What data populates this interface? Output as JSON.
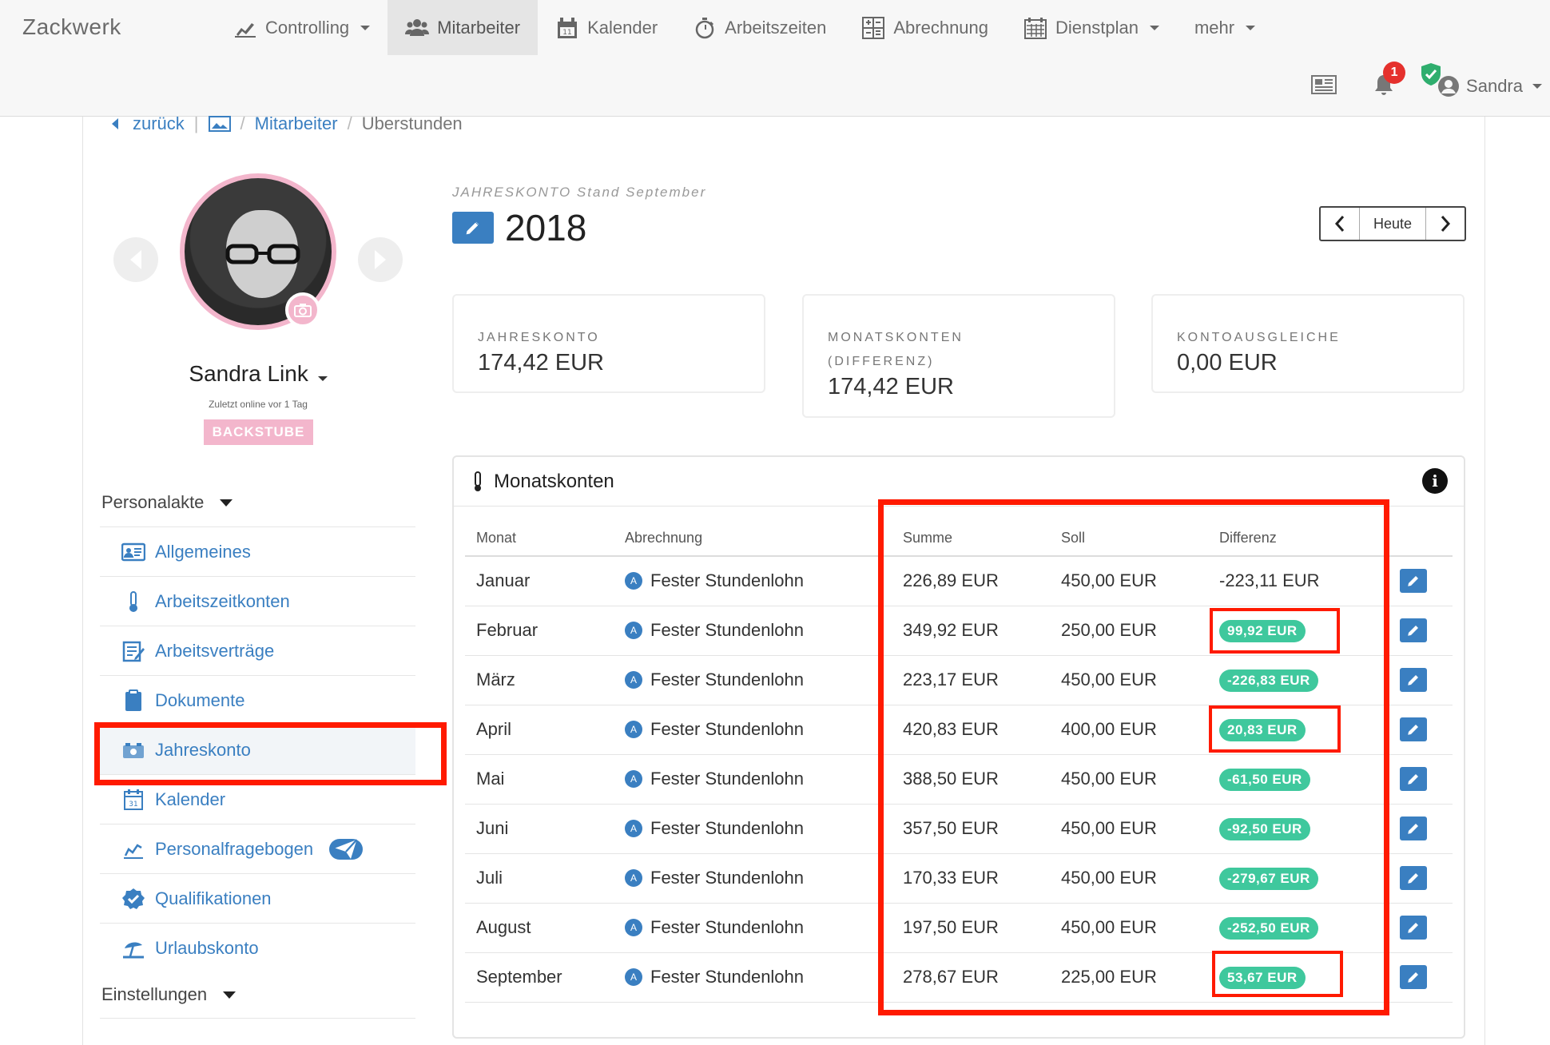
{
  "app": {
    "brand": "Zackwerk"
  },
  "nav": {
    "items": [
      {
        "label": "Controlling",
        "icon": "chart-icon",
        "dropdown": true
      },
      {
        "label": "Mitarbeiter",
        "icon": "users-icon",
        "active": true
      },
      {
        "label": "Kalender",
        "icon": "calendar-icon"
      },
      {
        "label": "Arbeitszeiten",
        "icon": "stopwatch-icon"
      },
      {
        "label": "Abrechnung",
        "icon": "calculator-icon"
      },
      {
        "label": "Dienstplan",
        "icon": "roster-icon",
        "dropdown": true
      },
      {
        "label": "mehr",
        "dropdown": true
      }
    ],
    "notifications_count": "1",
    "user_name": "Sandra"
  },
  "breadcrumb": {
    "back": "zurück",
    "parent": "Mitarbeiter",
    "current": "Uberstunden"
  },
  "profile": {
    "name": "Sandra Link",
    "last_online": "Zuletzt online vor 1 Tag",
    "department": "BACKSTUBE"
  },
  "sidebar": {
    "section_personalakte": "Personalakte",
    "items": [
      {
        "label": "Allgemeines",
        "icon": "id-card-icon"
      },
      {
        "label": "Arbeitszeitkonten",
        "icon": "thermometer-icon"
      },
      {
        "label": "Arbeitsverträge",
        "icon": "contract-icon"
      },
      {
        "label": "Dokumente",
        "icon": "clipboard-icon"
      },
      {
        "label": "Jahreskonto",
        "icon": "bank-icon",
        "active": true
      },
      {
        "label": "Kalender",
        "icon": "calendar-icon"
      },
      {
        "label": "Personalfragebogen",
        "icon": "form-icon"
      },
      {
        "label": "Qualifikationen",
        "icon": "badge-check-icon"
      },
      {
        "label": "Urlaubskonto",
        "icon": "beach-icon"
      }
    ],
    "section_einstellungen": "Einstellungen"
  },
  "header": {
    "kicker": "JAHRESKONTO Stand September",
    "year": "2018",
    "pager_today": "Heute"
  },
  "cards": [
    {
      "label": "JAHRESKONTO",
      "value": "174,42 EUR"
    },
    {
      "label": "MONATSKONTEN (DIFFERENZ)",
      "value": "174,42 EUR"
    },
    {
      "label": "KONTOAUSGLEICHE",
      "value": "0,00 EUR"
    }
  ],
  "panel": {
    "title": "Monatskonten",
    "columns": [
      "Monat",
      "Abrechnung",
      "Summe",
      "Soll",
      "Differenz"
    ],
    "rows": [
      {
        "monat": "Januar",
        "abrechnung": "Fester Stundenlohn",
        "summe": "226,89 EUR",
        "soll": "450,00 EUR",
        "differenz": "-223,11 EUR",
        "pill": false
      },
      {
        "monat": "Februar",
        "abrechnung": "Fester Stundenlohn",
        "summe": "349,92 EUR",
        "soll": "250,00 EUR",
        "differenz": "99,92 EUR",
        "pill": true
      },
      {
        "monat": "März",
        "abrechnung": "Fester Stundenlohn",
        "summe": "223,17 EUR",
        "soll": "450,00 EUR",
        "differenz": "-226,83 EUR",
        "pill": true
      },
      {
        "monat": "April",
        "abrechnung": "Fester Stundenlohn",
        "summe": "420,83 EUR",
        "soll": "400,00 EUR",
        "differenz": "20,83 EUR",
        "pill": true
      },
      {
        "monat": "Mai",
        "abrechnung": "Fester Stundenlohn",
        "summe": "388,50 EUR",
        "soll": "450,00 EUR",
        "differenz": "-61,50 EUR",
        "pill": true
      },
      {
        "monat": "Juni",
        "abrechnung": "Fester Stundenlohn",
        "summe": "357,50 EUR",
        "soll": "450,00 EUR",
        "differenz": "-92,50 EUR",
        "pill": true
      },
      {
        "monat": "Juli",
        "abrechnung": "Fester Stundenlohn",
        "summe": "170,33 EUR",
        "soll": "450,00 EUR",
        "differenz": "-279,67 EUR",
        "pill": true
      },
      {
        "monat": "August",
        "abrechnung": "Fester Stundenlohn",
        "summe": "197,50 EUR",
        "soll": "450,00 EUR",
        "differenz": "-252,50 EUR",
        "pill": true
      },
      {
        "monat": "September",
        "abrechnung": "Fester Stundenlohn",
        "summe": "278,67 EUR",
        "soll": "225,00 EUR",
        "differenz": "53,67 EUR",
        "pill": true
      }
    ],
    "abrechnung_badge": "A"
  },
  "colors": {
    "accent": "#3a7fc1",
    "positive_pill": "#3fc89d",
    "annotation": "#ff1a00",
    "profile_pink": "#f3b6cc"
  }
}
